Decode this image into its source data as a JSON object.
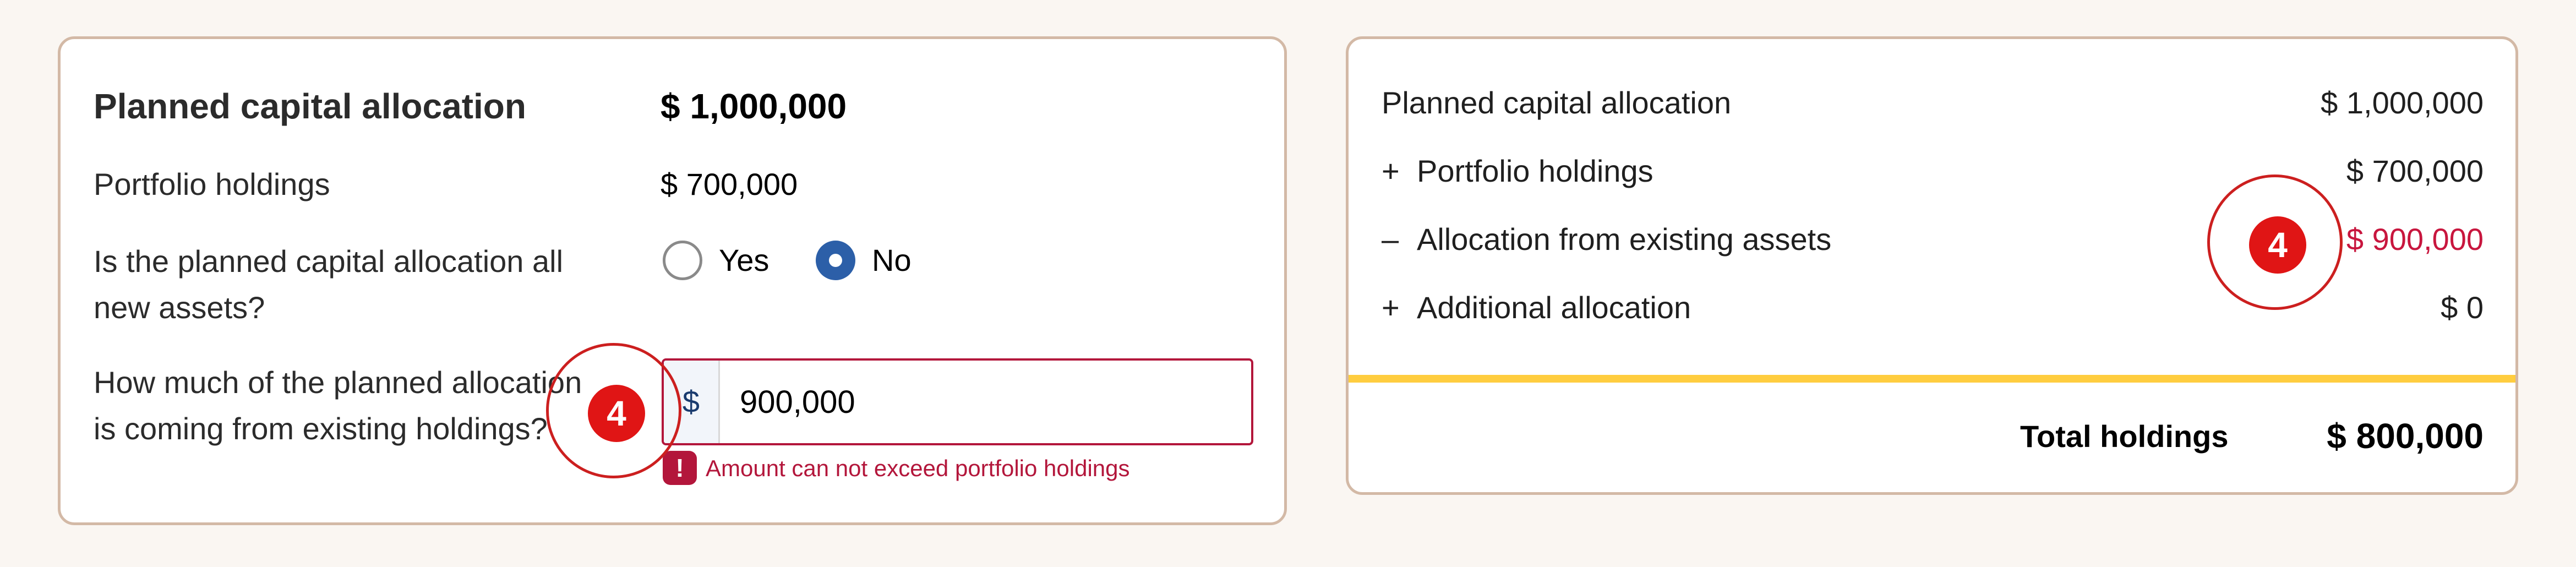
{
  "left_form": {
    "title": "Planned capital allocation",
    "title_value": "$ 1,000,000",
    "holdings_label": "Portfolio holdings",
    "holdings_value": "$ 700,000",
    "question_all_new": "Is the planned capital allocation all new assets?",
    "radio_yes": "Yes",
    "radio_no": "No",
    "selected_option": "No",
    "question_existing": "How much of the planned allocation is coming from existing holdings?",
    "currency_prefix": "$",
    "amount_value": "900,000",
    "error_icon": "!",
    "error_message": "Amount can not exceed portfolio holdings"
  },
  "summary": {
    "rows": [
      {
        "sign": "",
        "label": "Planned capital allocation",
        "value": "$ 1,000,000"
      },
      {
        "sign": "+",
        "label": "Portfolio holdings",
        "value": "$ 700,000"
      },
      {
        "sign": "–",
        "label": "Allocation from existing assets",
        "value": "$ 900,000"
      },
      {
        "sign": "+",
        "label": "Additional allocation",
        "value": "$ 0"
      }
    ],
    "total_label": "Total holdings",
    "total_value": "$ 800,000"
  },
  "annotations": {
    "marker_number": "4",
    "marker_color": "#e01515"
  },
  "colors": {
    "error": "#b3163b",
    "negative_value": "#c8163e",
    "radio_selected": "#2c5fa8",
    "divider": "#ffcd3f",
    "card_border": "#d3b9a6"
  }
}
